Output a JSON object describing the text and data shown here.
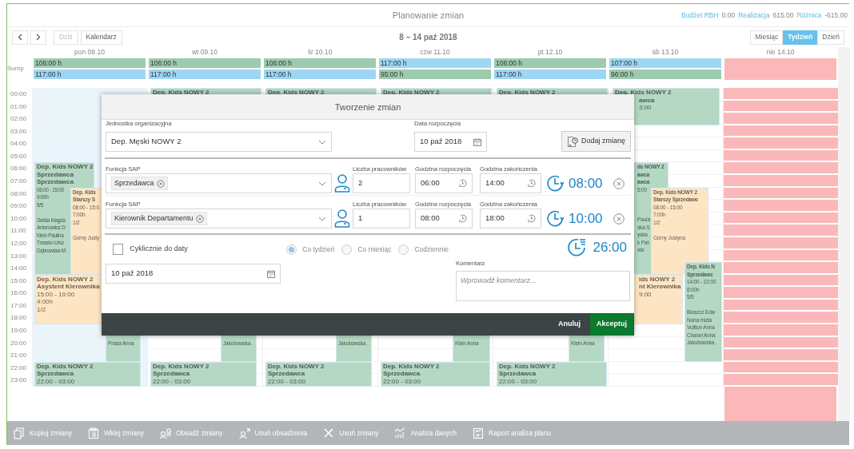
{
  "header": {
    "title": "Planowanie zmian",
    "stats": [
      {
        "label": "Budżet RBH",
        "value": "0.00"
      },
      {
        "label": "Realizacja",
        "value": "615.00"
      },
      {
        "label": "Różnica",
        "value": "-615.00"
      }
    ]
  },
  "toolbar": {
    "buttons": [
      {
        "label": "Dziś",
        "disabled": true
      },
      {
        "label": "Kalendarz",
        "disabled": false
      }
    ],
    "range": "8 – 14 paź 2018",
    "views": [
      {
        "label": "Miesiąc",
        "selected": false
      },
      {
        "label": "Tydzień",
        "selected": true
      },
      {
        "label": "Dzień",
        "selected": false
      }
    ]
  },
  "calendar": {
    "sums_label": "Sumy",
    "hours": [
      "00:00",
      "01:00",
      "02:00",
      "03:00",
      "04:00",
      "05:00",
      "06:00",
      "07:00",
      "08:00",
      "09:00",
      "10:00",
      "11:00",
      "12:00",
      "13:00",
      "14:00",
      "15:00",
      "16:00",
      "17:00",
      "18:00",
      "19:00",
      "20:00",
      "21:00",
      "22:00",
      "23:00"
    ],
    "days": [
      {
        "label": "pon 08.10",
        "today": true,
        "holiday": false,
        "sums": [
          {
            "text": "106:00 h",
            "color": "#9ccbae"
          },
          {
            "text": "117:00 h",
            "color": "#9dd6f2"
          }
        ],
        "events": [
          {
            "color": "#b4d8c3",
            "heading": [
              "Dep. Kids NOWY 2",
              "Sprzedawca",
              "Sprzedawca"
            ],
            "details": [
              "06:00 - 15:00",
              "9:00h",
              "5/5"
            ],
            "names": [
              "Sekita Magda",
              "Antonowicz D",
              "Klein Paulina",
              "Trzasko Ursz",
              "Dąbrowska M"
            ]
          },
          {
            "color": "#fde5c4",
            "heading": [
              "Dep. Kids",
              "Starszy S"
            ],
            "details": [
              "08:00 - 15:0",
              "7:00h",
              "1/2"
            ],
            "names": [
              "Górny Justy"
            ]
          },
          {
            "color": "#fde5c4",
            "heading": [
              "Dep. Kids NOWY 2",
              "Asystent Kierownika"
            ],
            "details": [
              "15:00 - 19:00",
              "4:00h",
              "1/2"
            ]
          },
          {
            "color": "#b4d8c3",
            "names": [
              "Prada Anna"
            ]
          },
          {
            "color": "#b4d8c3",
            "heading": [
              "Dep. Kids NOWY 2",
              "Sprzedawca"
            ],
            "details": [
              "22:00 - 03:00"
            ]
          }
        ]
      },
      {
        "label": "wt 09.10",
        "today": false,
        "holiday": false,
        "sums": [
          {
            "text": "106:00 h",
            "color": "#9ccbae"
          },
          {
            "text": "117:00 h",
            "color": "#9dd6f2"
          }
        ],
        "events": [
          {
            "color": "#b4d8c3",
            "heading": [
              "Dep. Kids NOWY 2"
            ]
          },
          {
            "color": "#b4d8c3",
            "names": [
              "Jakubowska ."
            ]
          },
          {
            "color": "#b4d8c3",
            "heading": [
              "Dep. Kids NOWY 2",
              "Sprzedawca"
            ],
            "details": [
              "22:00 - 03:00"
            ]
          }
        ]
      },
      {
        "label": "śr 10.10",
        "today": false,
        "holiday": false,
        "sums": [
          {
            "text": "106:00 h",
            "color": "#9ccbae"
          },
          {
            "text": "117:00 h",
            "color": "#9dd6f2"
          }
        ],
        "events": [
          {
            "color": "#b4d8c3",
            "heading": [
              "Dep. Kids NOWY 2"
            ]
          },
          {
            "color": "#b4d8c3",
            "names": [
              "Jakubowska ."
            ]
          },
          {
            "color": "#b4d8c3",
            "heading": [
              "Dep. Kids NOWY 2",
              "Sprzedawca"
            ],
            "details": [
              "22:00 - 03:00"
            ]
          }
        ]
      },
      {
        "label": "czw 11.10",
        "today": false,
        "holiday": false,
        "sums": [
          {
            "text": "117:00 h",
            "color": "#9dd6f2"
          },
          {
            "text": "95:00 h",
            "color": "#9ccbae"
          }
        ],
        "events": [
          {
            "color": "#b4d8c3",
            "heading": [
              "Dep. Kids NOWY 2"
            ]
          },
          {
            "color": "#b4d8c3",
            "names": [
              "Klein Anna"
            ]
          },
          {
            "color": "#b4d8c3",
            "heading": [
              "Dep. Kids NOWY 2",
              "Sprzedawca"
            ],
            "details": [
              "22:00 - 03:00"
            ]
          }
        ]
      },
      {
        "label": "pt 12.10",
        "today": false,
        "holiday": false,
        "sums": [
          {
            "text": "106:00 h",
            "color": "#9ccbae"
          },
          {
            "text": "117:00 h",
            "color": "#9dd6f2"
          }
        ],
        "events": [
          {
            "color": "#b4d8c3",
            "heading": [
              "Dep. Kids NOWY 2"
            ]
          },
          {
            "color": "#b4d8c3",
            "names": [
              "Klein Anna"
            ]
          },
          {
            "color": "#b4d8c3",
            "heading": [
              "Dep. Kids NOWY 2",
              "Sprzedawca"
            ],
            "details": [
              "22:00 - 03:00"
            ]
          }
        ]
      },
      {
        "label": "sb 13.10",
        "today": false,
        "holiday": false,
        "sums": [
          {
            "text": "107:00 h",
            "color": "#9dd6f2"
          },
          {
            "text": "96:00 h",
            "color": "#9ccbae"
          }
        ],
        "events": [
          {
            "color": "#b4d8c3",
            "heading": [
              "Dep. Kids NOWY 2",
              "awca"
            ],
            "details": [
              "3:00"
            ]
          },
          {
            "color": "#b4d8c3",
            "heading": [
              "ds NOWY 2",
              "awca",
              "awca"
            ],
            "details": [
              "5:00"
            ],
            "names": [
              "Paula",
              "ska S",
              "yska .",
              "k Pat",
              "ata"
            ]
          },
          {
            "color": "#fde5c4",
            "heading": [
              "Dep. Kids NOWY 2",
              "Starszy Sprzedawc"
            ],
            "details": [
              "08:00 - 15:00",
              "7:00h",
              "1/2"
            ],
            "names": [
              "Górny Justyna"
            ]
          },
          {
            "color": "#fde5c4",
            "heading": [
              "ids NOWY 2",
              "nt Kierownika"
            ],
            "details": [
              "9:00"
            ]
          },
          {
            "color": "#b4d8c3",
            "heading": [
              "Dep. Kids N",
              "Sprzedawc"
            ],
            "details": [
              "14:00 - 22:00",
              "8:00h",
              "5/5"
            ],
            "names": [
              "Bluszcz Edw",
              "Nuna mizia",
              "Vuitton Anna",
              "Chanel Anna",
              "Jakubowska ."
            ]
          }
        ]
      },
      {
        "label": "nie 14.10",
        "today": false,
        "holiday": true
      }
    ]
  },
  "dialog": {
    "title": "Tworzenie zmian",
    "unit": {
      "label": "Jednostka organizacyjna",
      "value": "Dep. Męski NOWY 2"
    },
    "start_date": {
      "label": "Data rozpoczęcia",
      "value": "10 paź 2018"
    },
    "add_button": "Dodaj zmianę",
    "shifts": [
      {
        "function_label": "Funkcja SAP",
        "function": "Sprzedawca",
        "count_label": "Liczba pracowników",
        "count": "2",
        "start_label": "Godzina rozpoczęcia",
        "start": "06:00",
        "end_label": "Godzina zakończenia",
        "end": "14:00",
        "duration": "08:00"
      },
      {
        "function_label": "Funkcja SAP",
        "function": "Kierownik Departamentu",
        "count_label": "Liczba pracowników",
        "count": "1",
        "start_label": "Godzina rozpoczęcia",
        "start": "08:00",
        "end_label": "Godzina zakończenia",
        "end": "18:00",
        "duration": "10:00"
      }
    ],
    "recurring": {
      "label": "Cyklicznie do daty",
      "checked": false
    },
    "frequency": [
      {
        "label": "Co tydzień",
        "selected": true,
        "disabled": true
      },
      {
        "label": "Co miesiąc",
        "selected": false,
        "disabled": true
      },
      {
        "label": "Codziennie",
        "selected": false,
        "disabled": true
      }
    ],
    "total": "26:00",
    "until_date": "10 paź 2018",
    "comment": {
      "label": "Komentarz",
      "placeholder": "Wprowadź komentarz..."
    },
    "buttons": [
      {
        "label": "Anuluj",
        "kind": "cancel"
      },
      {
        "label": "Akceptuj",
        "kind": "accept"
      }
    ]
  },
  "actions": [
    {
      "label": "Kopiuj zmiany",
      "kind": "copy"
    },
    {
      "label": "Wklej zmiany",
      "kind": "paste"
    },
    {
      "label": "Obsadź zmiany",
      "kind": "assign"
    },
    {
      "label": "Usuń obsadzenia",
      "kind": "unassign"
    },
    {
      "label": "Usuń zmiany",
      "kind": "delete"
    },
    {
      "label": "Analiza danych",
      "kind": "analysis"
    },
    {
      "label": "Raport analiza planu",
      "kind": "report"
    }
  ]
}
